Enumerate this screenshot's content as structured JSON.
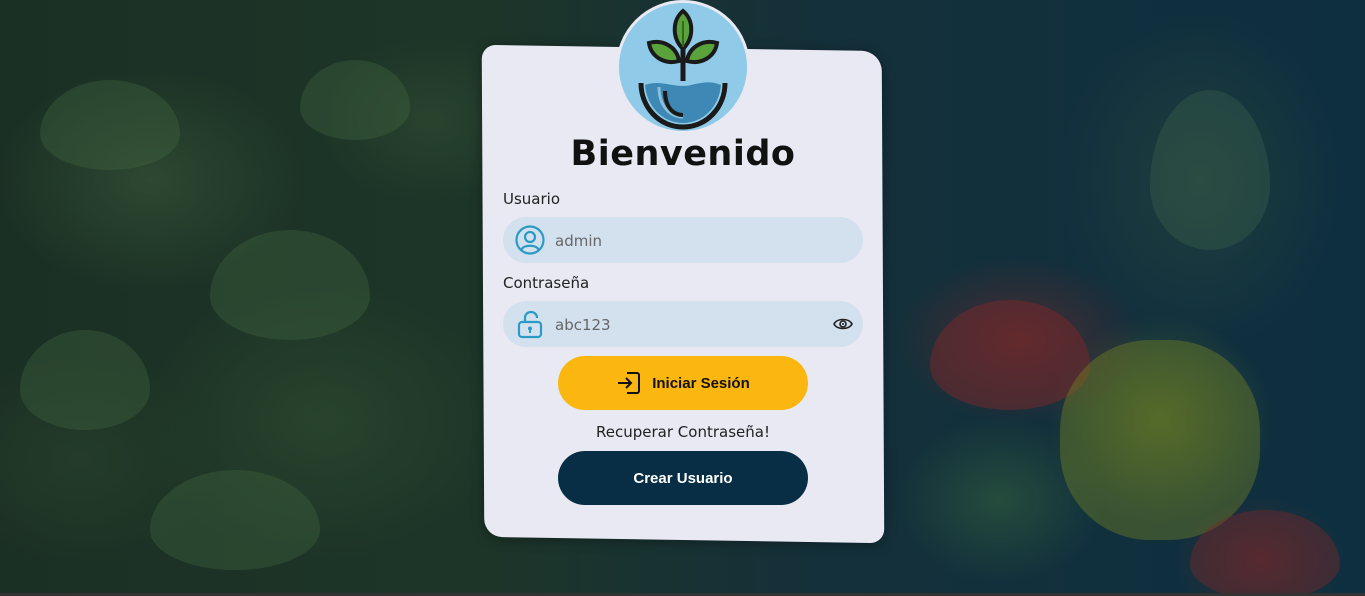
{
  "login": {
    "title": "Bienvenido",
    "user_label": "Usuario",
    "user_value": "admin",
    "password_label": "Contraseña",
    "password_value": "abc123",
    "login_button": "Iniciar Sesión",
    "recover_link": "Recuperar Contraseña!",
    "create_button": "Crear Usuario"
  },
  "icons": {
    "logo": "plant-sprout-logo",
    "user": "user-circle-icon",
    "lock": "lock-icon",
    "eye": "eye-icon",
    "login": "sign-in-icon"
  },
  "colors": {
    "card_bg": "#e8e9f3",
    "field_bg": "#d3e1ef",
    "accent_yellow": "#fbb60f",
    "dark_navy": "#082e45",
    "icon_blue": "#2a9bc4"
  }
}
